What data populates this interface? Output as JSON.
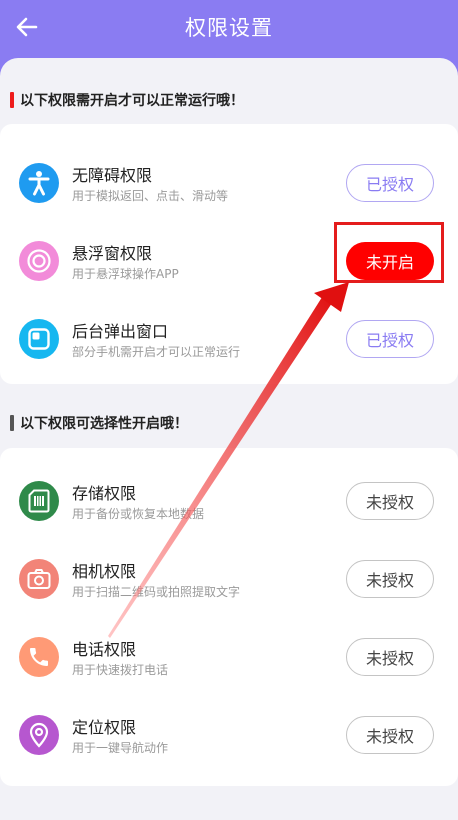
{
  "header": {
    "title": "权限设置"
  },
  "sections": [
    {
      "title": "以下权限需开启才可以正常运行哦！",
      "bar_color": "#ee1c1c",
      "items": [
        {
          "name": "无障碍权限",
          "desc": "用于模拟返回、点击、滑动等",
          "button": "已授权",
          "icon": "accessibility-icon",
          "color": "#1f9bf0"
        },
        {
          "name": "悬浮窗权限",
          "desc": "用于悬浮球操作APP",
          "button": "未开启",
          "icon": "floating-ball-icon",
          "color": "#f28bd9"
        },
        {
          "name": "后台弹出窗口",
          "desc": "部分手机需开启才可以正常运行",
          "button": "已授权",
          "icon": "popup-window-icon",
          "color": "#16b7f0"
        }
      ]
    },
    {
      "title": "以下权限可选择性开启哦！",
      "bar_color": "#555555",
      "items": [
        {
          "name": "存储权限",
          "desc": "用于备份或恢复本地数据",
          "button": "未授权",
          "icon": "sd-card-icon",
          "color": "#2f8a4a"
        },
        {
          "name": "相机权限",
          "desc": "用于扫描二维码或拍照提取文字",
          "button": "未授权",
          "icon": "camera-icon",
          "color": "#f28478"
        },
        {
          "name": "电话权限",
          "desc": "用于快速拨打电话",
          "button": "未授权",
          "icon": "phone-icon",
          "color": "#ff9a76"
        },
        {
          "name": "定位权限",
          "desc": "用于一键导航动作",
          "button": "未授权",
          "icon": "location-pin-icon",
          "color": "#b657cf"
        }
      ]
    }
  ],
  "colors": {
    "accent": "#8a7cf2",
    "alert": "#ff0000"
  }
}
